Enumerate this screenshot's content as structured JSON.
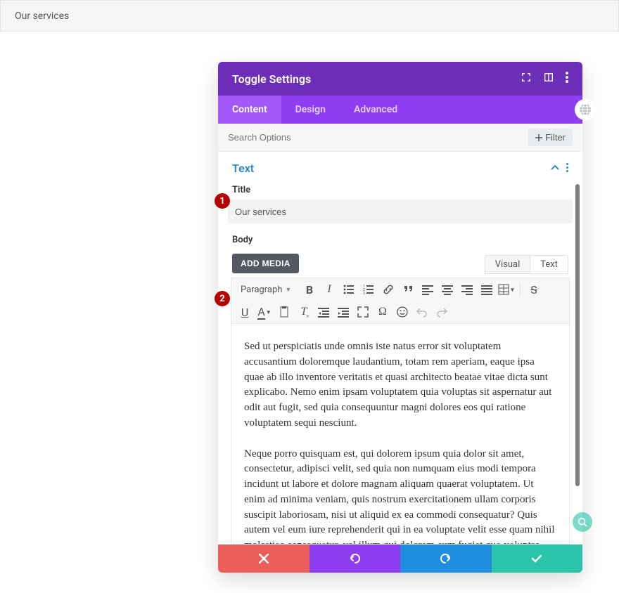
{
  "topbar": {
    "label": "Our services"
  },
  "modal": {
    "title": "Toggle Settings",
    "tabs": {
      "content": "Content",
      "design": "Design",
      "advanced": "Advanced"
    },
    "search_placeholder": "Search Options",
    "filter_label": "Filter"
  },
  "section": {
    "name": "Text",
    "title_label": "Title",
    "title_value": "Our services",
    "body_label": "Body",
    "add_media": "ADD MEDIA",
    "editor_tabs": {
      "visual": "Visual",
      "text": "Text"
    },
    "format_select": "Paragraph"
  },
  "editor": {
    "p1": "Sed ut perspiciatis unde omnis iste natus error sit voluptatem accusantium doloremque laudantium, totam rem aperiam, eaque ipsa quae ab illo inventore veritatis et quasi architecto beatae vitae dicta sunt explicabo. Nemo enim ipsam voluptatem quia voluptas sit aspernatur aut odit aut fugit, sed quia consequuntur magni dolores eos qui ratione voluptatem sequi nesciunt.",
    "p2": "Neque porro quisquam est, qui dolorem ipsum quia dolor sit amet, consectetur, adipisci velit, sed quia non numquam eius modi tempora incidunt ut labore et dolore magnam aliquam quaerat voluptatem. Ut enim ad minima veniam, quis nostrum exercitationem ullam corporis suscipit laboriosam, nisi ut aliquid ex ea commodi consequatur? Quis autem vel eum iure reprehenderit qui in ea voluptate velit esse quam nihil molestiae consequatur, vel illum qui dolorem eum fugiat quo voluptas nulla pariatur?"
  },
  "badges": {
    "one": "1",
    "two": "2"
  }
}
